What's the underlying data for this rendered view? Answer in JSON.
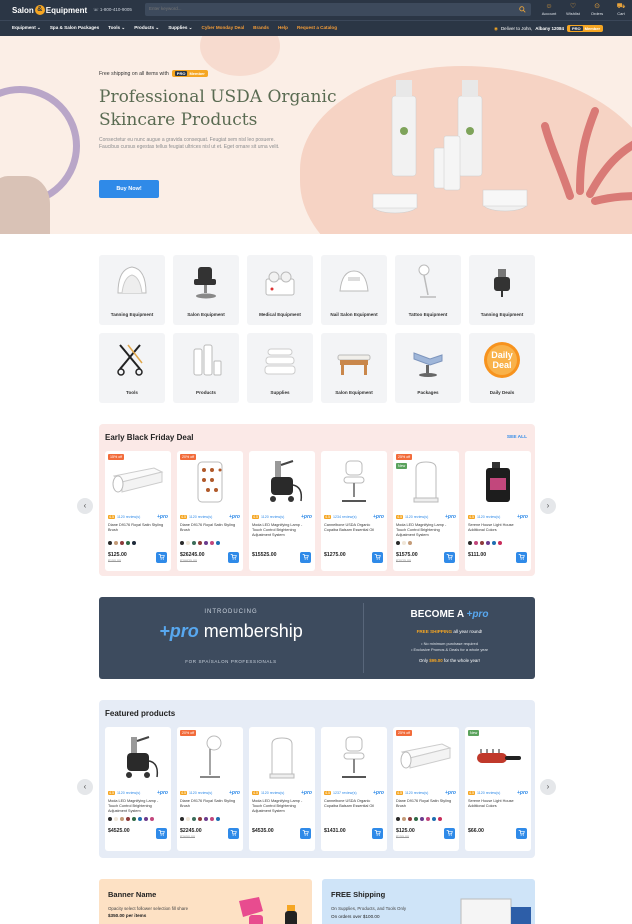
{
  "header": {
    "logo_left": "Salon",
    "logo_amp": "&",
    "logo_right": "Equipment",
    "phone": "1-800-410-9005",
    "search_placeholder": "Enter keyword...",
    "icons": [
      {
        "name": "account",
        "label": "Account"
      },
      {
        "name": "wishlist",
        "label": "Wishlist"
      },
      {
        "name": "orders",
        "label": "Orders"
      },
      {
        "name": "cart",
        "label": "Cart"
      }
    ]
  },
  "nav": {
    "items": [
      "Equipment ⌄",
      "Spa & Salon Packages",
      "Tools ⌄",
      "Products ⌄",
      "Supplies ⌄"
    ],
    "special": [
      "Cyber Monday Deal",
      "Brands",
      "Help",
      "Request a Catalog"
    ],
    "deliver_label": "Deliver to John,",
    "deliver_location": "Albany 12084",
    "pro_badge_pro": "PRO",
    "pro_badge_text": "Member"
  },
  "hero": {
    "shipping_text": "Free shipping on all items with",
    "pro_pro": "PRO",
    "pro_member": "Member",
    "title": "Professional USDA Organic Skincare Products",
    "description": "Consectetur eu nunc augue a gravida consequat. Feugiat sem nisl leo posuere. Faucibus cursus egestas tellus feugiat ultrices nisl ut et. Eget ornare sit urna velit.",
    "button": "Buy Now!"
  },
  "categories": [
    {
      "label": "Tanning Equipment",
      "icon": "tanning-pod-icon"
    },
    {
      "label": "Salon Equipment",
      "icon": "salon-chair-icon"
    },
    {
      "label": "Medical Equipment",
      "icon": "medical-device-icon"
    },
    {
      "label": "Nail Salon Equipment",
      "icon": "nail-lamp-icon"
    },
    {
      "label": "Tattoo Equipment",
      "icon": "tattoo-lamp-icon"
    },
    {
      "label": "Tanning Equipment",
      "icon": "spray-tan-icon"
    },
    {
      "label": "Tools",
      "icon": "scissors-icon"
    },
    {
      "label": "Products",
      "icon": "bottles-icon"
    },
    {
      "label": "Supplies",
      "icon": "towels-icon"
    },
    {
      "label": "Salon Equipment",
      "icon": "massage-bed-icon"
    },
    {
      "label": "Packages",
      "icon": "package-chair-icon"
    },
    {
      "label": "Daily Deals",
      "icon": "daily-deal-icon"
    }
  ],
  "black_friday": {
    "title": "Early Black Friday Deal",
    "see_all": "SEE ALL",
    "products": [
      {
        "tag": "15% off",
        "tag_type": "sale",
        "rating": "4.5",
        "reviews": "1120 review(s)",
        "name": "Diane D9176 Royal Satin Styling Brush",
        "price": "$125.00",
        "old": "$150.00",
        "img": "paper-roll-icon",
        "colors": [
          "#2b2b2b",
          "#c49b78",
          "#8e3b3b",
          "#2f6a46",
          "#1e2a3a"
        ]
      },
      {
        "tag": "20% off",
        "tag_type": "sale",
        "rating": "4.5",
        "reviews": "1120 review(s)",
        "name": "Diane D9176 Royal Satin Styling Brush",
        "price": "$26245.00",
        "old": "$29835.00",
        "img": "lamp-shade-icon",
        "colors": [
          "#2b2b2b",
          "#f0e6d8",
          "#3c6e5a",
          "#8e3b3b",
          "#6b3c8e",
          "#c2477c",
          "#1f6fb2"
        ]
      },
      {
        "tag": "",
        "tag_type": "",
        "rating": "4.5",
        "reviews": "1120 review(s)",
        "name": "Moda LED Magnifying Lamp - Touch Control Brightening Adjustment System",
        "price": "$15525.00",
        "old": "",
        "img": "spray-machine-icon",
        "colors": []
      },
      {
        "tag": "",
        "tag_type": "",
        "rating": "4.5",
        "reviews": "1234 review(s)",
        "name": "Cannelbone USDA Organic Copaiba Balsam Essential Oil",
        "price": "$1275.00",
        "old": "",
        "img": "stool-icon",
        "colors": []
      },
      {
        "tag": "25% off",
        "tag_type": "sale",
        "tag2": "New",
        "rating": "4.5",
        "reviews": "1120 review(s)",
        "name": "Moda LED Magnifying Lamp - Touch Control Brightening Adjustment System",
        "price": "$1575.00",
        "old": "$2025.00",
        "img": "steamer-icon",
        "colors": [
          "#2b2b2b",
          "#f0e6d8",
          "#c49b78"
        ]
      },
      {
        "tag": "",
        "tag_type": "",
        "rating": "4.5",
        "reviews": "1120 review(s)",
        "name": "Serene House Light House Additional Colors",
        "price": "$111.00",
        "old": "",
        "img": "gallon-icon",
        "colors": [
          "#2b2b2b",
          "#c2477c",
          "#8e3b3b",
          "#6b3c8e",
          "#1f6fb2",
          "#c82c5a"
        ]
      }
    ]
  },
  "promo": {
    "introducing": "INTRODUCING",
    "pro": "+pro",
    "membership": " membership",
    "for_spa": "FOR SPA/SALON PROFESSIONALS",
    "become": "BECOME A",
    "become_pro": "+pro",
    "free_shipping": "FREE SHIPPING",
    "free_shipping_rest": " all year round!",
    "bullet1": "• No minimum purchase required",
    "bullet2": "• Exclusive Promos & Deals for a whole year",
    "only": "Only ",
    "price": "$99.00",
    "only_rest": " for the whole year!"
  },
  "featured": {
    "title": "Featured products",
    "products": [
      {
        "tag": "",
        "tag_type": "",
        "rating": "4.5",
        "reviews": "1120 review(s)",
        "name": "Moda LED Magnifying Lamp - Touch Control Brightening Adjustment System",
        "price": "$4525.00",
        "old": "",
        "img": "spray-machine-icon",
        "colors": [
          "#2b2b2b",
          "#f0e6d8",
          "#c49b78",
          "#8e3b3b",
          "#2f6a46",
          "#1f6fb2",
          "#6b3c8e",
          "#c2477c"
        ]
      },
      {
        "tag": "20% off",
        "tag_type": "sale",
        "rating": "4.5",
        "reviews": "1120 review(s)",
        "name": "Diane D9176 Royal Satin Styling Brush",
        "price": "$2245.00",
        "old": "$2650.00",
        "img": "floor-lamp-icon",
        "colors": [
          "#2b2b2b",
          "#f0e6d8",
          "#3c6e5a",
          "#8e3b3b",
          "#6b3c8e",
          "#c2477c",
          "#1f6fb2"
        ]
      },
      {
        "tag": "",
        "tag_type": "",
        "rating": "4.5",
        "reviews": "1120 review(s)",
        "name": "Moda LED Magnifying Lamp - Touch Control Brightening Adjustment System",
        "price": "$4535.00",
        "old": "",
        "img": "steamer-icon",
        "colors": []
      },
      {
        "tag": "",
        "tag_type": "",
        "rating": "4.5",
        "reviews": "1237 review(s)",
        "name": "Cannelbone USDA Organic Copaiba Balsam Essential Oil",
        "price": "$1431.00",
        "old": "",
        "img": "stool-icon",
        "colors": []
      },
      {
        "tag": "25% off",
        "tag_type": "sale",
        "rating": "4.5",
        "reviews": "1120 review(s)",
        "name": "Diane D9176 Royal Satin Styling Brush",
        "price": "$125.00",
        "old": "$155.00",
        "img": "paper-roll-icon",
        "colors": [
          "#2b2b2b",
          "#c49b78",
          "#8e3b3b",
          "#2f6a46",
          "#6b3c8e",
          "#c2477c",
          "#1f6fb2",
          "#c82c5a"
        ]
      },
      {
        "tag": "New",
        "tag_type": "new",
        "rating": "4.5",
        "reviews": "1120 review(s)",
        "name": "Serene House Light House Additional Colors",
        "price": "$66.00",
        "old": "",
        "img": "brush-icon",
        "colors": []
      }
    ]
  },
  "banners": [
    {
      "title": "Banner Name",
      "sub": "Opacity select follower selection fill share",
      "sub2": "$350.00 per items"
    },
    {
      "title": "FREE Shipping",
      "sub": "On Supplies, Products, and Tools Only",
      "sub2": "On orders over $100.00"
    }
  ],
  "colors": {
    "header": "#2b3645",
    "accent": "#2f8ae8",
    "orange": "#f5a623",
    "sale": "#f26b3a"
  }
}
